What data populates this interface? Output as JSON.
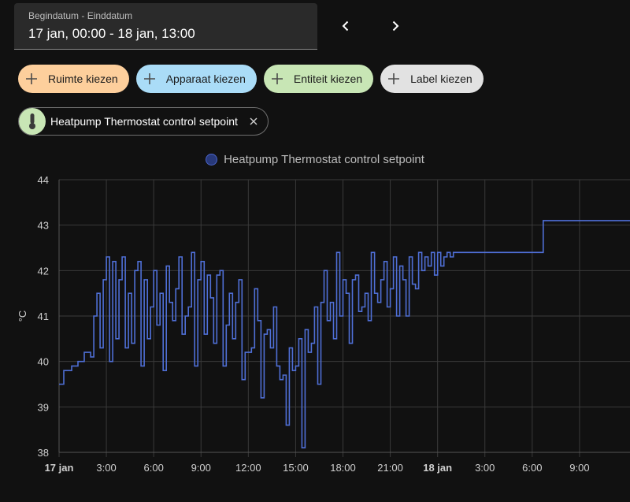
{
  "date_range": {
    "label": "Begindatum - Einddatum",
    "value": "17 jan, 00:00 - 18 jan, 13:00"
  },
  "target_chips": [
    {
      "label": "Ruimte kiezen",
      "color": "#fdcf9c"
    },
    {
      "label": "Apparaat kiezen",
      "color": "#aadcf7"
    },
    {
      "label": "Entiteit kiezen",
      "color": "#c8e6b5"
    },
    {
      "label": "Label kiezen",
      "color": "#e2e2e2"
    }
  ],
  "selected_entity": {
    "label": "Heatpump Thermostat control setpoint",
    "icon": "thermometer-icon"
  },
  "chart_data": {
    "type": "line",
    "legend": "Heatpump Thermostat control setpoint",
    "series_color": "#4f6fd6",
    "ylabel": "°C",
    "ylim": [
      38,
      44
    ],
    "y_ticks": [
      "38",
      "39",
      "40",
      "41",
      "42",
      "43",
      "44"
    ],
    "x_ticks": [
      {
        "label": "17 jan",
        "hour": 0,
        "bold": true
      },
      {
        "label": "3:00",
        "hour": 3
      },
      {
        "label": "6:00",
        "hour": 6
      },
      {
        "label": "9:00",
        "hour": 9
      },
      {
        "label": "12:00",
        "hour": 12
      },
      {
        "label": "15:00",
        "hour": 15
      },
      {
        "label": "18:00",
        "hour": 18
      },
      {
        "label": "21:00",
        "hour": 21
      },
      {
        "label": "18 jan",
        "hour": 24,
        "bold": true
      },
      {
        "label": "3:00",
        "hour": 27
      },
      {
        "label": "6:00",
        "hour": 30
      },
      {
        "label": "9:00",
        "hour": 33
      }
    ],
    "xlim_hours": [
      0,
      36.2
    ],
    "grid": true,
    "series": [
      {
        "name": "Heatpump Thermostat control setpoint",
        "x_hours": [
          0.0,
          0.3,
          0.8,
          1.2,
          1.6,
          2.0,
          2.2,
          2.4,
          2.6,
          2.8,
          3.0,
          3.2,
          3.4,
          3.6,
          3.8,
          4.0,
          4.2,
          4.4,
          4.6,
          4.8,
          5.0,
          5.2,
          5.4,
          5.6,
          5.8,
          6.0,
          6.2,
          6.4,
          6.6,
          6.8,
          7.0,
          7.2,
          7.4,
          7.6,
          7.8,
          8.0,
          8.2,
          8.4,
          8.6,
          8.8,
          9.0,
          9.2,
          9.4,
          9.6,
          9.8,
          10.0,
          10.2,
          10.4,
          10.6,
          10.8,
          11.0,
          11.2,
          11.4,
          11.6,
          11.8,
          12.0,
          12.2,
          12.4,
          12.6,
          12.8,
          13.0,
          13.2,
          13.4,
          13.6,
          13.8,
          14.0,
          14.2,
          14.4,
          14.6,
          14.8,
          15.0,
          15.2,
          15.4,
          15.6,
          15.8,
          16.0,
          16.2,
          16.4,
          16.6,
          16.8,
          17.0,
          17.2,
          17.4,
          17.6,
          17.8,
          18.0,
          18.2,
          18.4,
          18.6,
          18.8,
          19.0,
          19.2,
          19.4,
          19.6,
          19.8,
          20.0,
          20.2,
          20.4,
          20.6,
          20.8,
          21.0,
          21.2,
          21.4,
          21.6,
          21.8,
          22.0,
          22.2,
          22.4,
          22.6,
          22.8,
          23.0,
          23.2,
          23.4,
          23.6,
          23.8,
          24.0,
          24.2,
          24.4,
          24.6,
          24.8,
          25.0,
          25.5,
          26.0,
          27.0,
          28.0,
          29.0,
          30.0,
          30.7,
          31.0,
          32.0,
          33.0,
          34.0,
          35.0,
          36.2
        ],
        "values": [
          39.5,
          39.8,
          39.9,
          40.0,
          40.2,
          40.1,
          41.0,
          41.5,
          40.3,
          41.8,
          42.3,
          40.0,
          42.2,
          40.5,
          41.8,
          42.3,
          40.3,
          41.5,
          40.4,
          42.0,
          42.2,
          39.9,
          41.8,
          40.5,
          41.2,
          42.0,
          40.8,
          41.5,
          39.8,
          42.1,
          41.3,
          40.9,
          41.6,
          42.3,
          40.6,
          41.0,
          41.2,
          42.4,
          39.9,
          41.8,
          42.2,
          40.6,
          41.9,
          41.4,
          40.4,
          41.9,
          42.0,
          39.9,
          40.8,
          41.5,
          40.5,
          41.3,
          41.8,
          39.6,
          40.2,
          40.2,
          40.3,
          41.6,
          40.9,
          39.2,
          40.6,
          40.7,
          40.3,
          41.2,
          39.9,
          39.6,
          39.7,
          38.6,
          40.3,
          39.8,
          39.9,
          40.5,
          38.1,
          40.7,
          40.2,
          40.4,
          41.2,
          39.5,
          41.3,
          42.0,
          40.9,
          41.3,
          40.5,
          42.4,
          41.0,
          41.8,
          41.5,
          40.4,
          41.8,
          41.9,
          41.1,
          41.2,
          41.5,
          40.9,
          42.4,
          41.5,
          41.3,
          41.8,
          42.2,
          41.2,
          41.6,
          42.3,
          41.0,
          42.1,
          41.8,
          41.0,
          42.3,
          41.7,
          41.6,
          42.4,
          42.0,
          42.3,
          42.1,
          42.4,
          41.9,
          42.4,
          42.1,
          42.3,
          42.4,
          42.3,
          42.4,
          42.4,
          42.4,
          42.4,
          42.4,
          42.4,
          42.4,
          43.1,
          43.1,
          43.1,
          43.1,
          43.1,
          43.1,
          43.1
        ]
      }
    ]
  }
}
